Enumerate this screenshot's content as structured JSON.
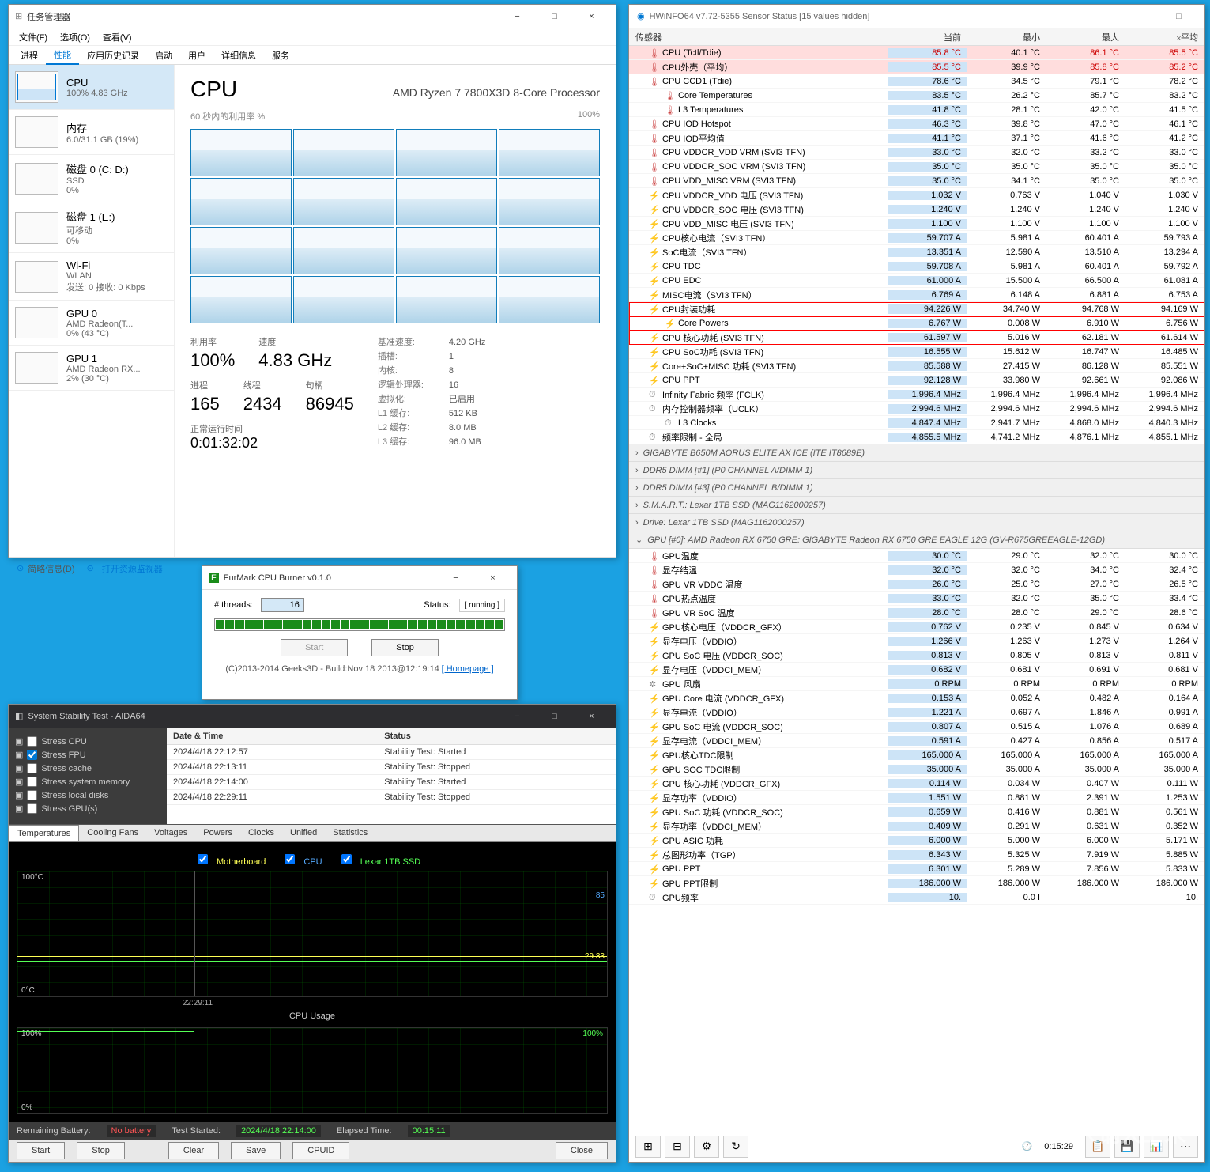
{
  "taskmgr": {
    "title": "任务管理器",
    "menu": [
      "文件(F)",
      "选项(O)",
      "查看(V)"
    ],
    "tabs": [
      "进程",
      "性能",
      "应用历史记录",
      "启动",
      "用户",
      "详细信息",
      "服务"
    ],
    "activeTab": 1,
    "sideItems": [
      {
        "name": "CPU",
        "sub": "100% 4.83 GHz",
        "active": true
      },
      {
        "name": "内存",
        "sub": "6.0/31.1 GB (19%)"
      },
      {
        "name": "磁盘 0 (C: D:)",
        "sub": "SSD\n0%"
      },
      {
        "name": "磁盘 1 (E:)",
        "sub": "可移动\n0%"
      },
      {
        "name": "Wi-Fi",
        "sub": "WLAN\n发送: 0 接收: 0 Kbps"
      },
      {
        "name": "GPU 0",
        "sub": "AMD Radeon(T...\n0% (43 °C)"
      },
      {
        "name": "GPU 1",
        "sub": "AMD Radeon RX...\n2% (30 °C)"
      }
    ],
    "cpuTitle": "CPU",
    "cpuModel": "AMD Ryzen 7 7800X3D 8-Core Processor",
    "graphLabel": "60 秒内的利用率 %",
    "graphMax": "100%",
    "stats": {
      "util": {
        "lbl": "利用率",
        "val": "100%"
      },
      "speed": {
        "lbl": "速度",
        "val": "4.83 GHz"
      },
      "proc": {
        "lbl": "进程",
        "val": "165"
      },
      "threads": {
        "lbl": "线程",
        "val": "2434"
      },
      "handles": {
        "lbl": "句柄",
        "val": "86945"
      },
      "uptime": {
        "lbl": "正常运行时间",
        "val": "0:01:32:02"
      }
    },
    "info": [
      {
        "k": "基准速度:",
        "v": "4.20 GHz"
      },
      {
        "k": "插槽:",
        "v": "1"
      },
      {
        "k": "内核:",
        "v": "8"
      },
      {
        "k": "逻辑处理器:",
        "v": "16"
      },
      {
        "k": "虚拟化:",
        "v": "已启用"
      },
      {
        "k": "L1 缓存:",
        "v": "512 KB"
      },
      {
        "k": "L2 缓存:",
        "v": "8.0 MB"
      },
      {
        "k": "L3 缓存:",
        "v": "96.0 MB"
      }
    ],
    "footer": {
      "label": "简略信息(D)",
      "link": "打开资源监视器"
    }
  },
  "furmark": {
    "title": "FurMark CPU Burner v0.1.0",
    "threadsLabel": "# threads:",
    "threads": "16",
    "statusLabel": "Status:",
    "status": "[ running ]",
    "start": "Start",
    "stop": "Stop",
    "footer": "(C)2013-2014 Geeks3D - Build:Nov 18 2013@12:19:14",
    "homepage": "[ Homepage ]"
  },
  "aida": {
    "title": "System Stability Test - AIDA64",
    "checks": [
      {
        "label": "Stress CPU",
        "checked": false
      },
      {
        "label": "Stress FPU",
        "checked": true
      },
      {
        "label": "Stress cache",
        "checked": false
      },
      {
        "label": "Stress system memory",
        "checked": false
      },
      {
        "label": "Stress local disks",
        "checked": false
      },
      {
        "label": "Stress GPU(s)",
        "checked": false
      }
    ],
    "logHeaders": [
      "Date & Time",
      "Status"
    ],
    "log": [
      {
        "dt": "2024/4/18 22:12:57",
        "st": "Stability Test: Started"
      },
      {
        "dt": "2024/4/18 22:13:11",
        "st": "Stability Test: Stopped"
      },
      {
        "dt": "2024/4/18 22:14:00",
        "st": "Stability Test: Started"
      },
      {
        "dt": "2024/4/18 22:29:11",
        "st": "Stability Test: Stopped"
      }
    ],
    "chartTabs": [
      "Temperatures",
      "Cooling Fans",
      "Voltages",
      "Powers",
      "Clocks",
      "Unified",
      "Statistics"
    ],
    "legend": [
      "Motherboard",
      "CPU",
      "Lexar 1TB SSD"
    ],
    "tempMax": "100°C",
    "tempMin": "0°C",
    "tempMarks": {
      "hi": "85",
      "mid": "29 33"
    },
    "timeMark": "22:29:11",
    "cpuUsageTitle": "CPU Usage",
    "usageMax": "100%",
    "usageMin": "0%",
    "status": {
      "battLabel": "Remaining Battery:",
      "batt": "No battery",
      "startLabel": "Test Started:",
      "start": "2024/4/18 22:14:00",
      "elapsedLabel": "Elapsed Time:",
      "elapsed": "00:15:11"
    },
    "btns": [
      "Start",
      "Stop",
      "Clear",
      "Save",
      "CPUID",
      "Close"
    ]
  },
  "hwinfo": {
    "title": "HWiNFO64 v7.72-5355 Sensor Status [15 values hidden]",
    "headers": {
      "sensor": "传感器",
      "cur": "当前",
      "min": "最小",
      "max": "最大",
      "avg": "平均"
    },
    "cpuRows": [
      {
        "name": "CPU (Tctl/Tdie)",
        "c": "85.8 °C",
        "mn": "40.1 °C",
        "mx": "86.1 °C",
        "av": "85.5 °C",
        "hl": true,
        "icon": "🌡"
      },
      {
        "name": "CPU外壳（平均）",
        "c": "85.5 °C",
        "mn": "39.9 °C",
        "mx": "85.8 °C",
        "av": "85.2 °C",
        "hl": true,
        "icon": "🌡"
      },
      {
        "name": "CPU CCD1 (Tdie)",
        "c": "78.6 °C",
        "mn": "34.5 °C",
        "mx": "79.1 °C",
        "av": "78.2 °C",
        "icon": "🌡"
      },
      {
        "name": "Core Temperatures",
        "c": "83.5 °C",
        "mn": "26.2 °C",
        "mx": "85.7 °C",
        "av": "83.2 °C",
        "icon": "🌡",
        "indent": true
      },
      {
        "name": "L3 Temperatures",
        "c": "41.8 °C",
        "mn": "28.1 °C",
        "mx": "42.0 °C",
        "av": "41.5 °C",
        "icon": "🌡",
        "indent": true
      },
      {
        "name": "CPU IOD Hotspot",
        "c": "46.3 °C",
        "mn": "39.8 °C",
        "mx": "47.0 °C",
        "av": "46.1 °C",
        "icon": "🌡"
      },
      {
        "name": "CPU IOD平均值",
        "c": "41.1 °C",
        "mn": "37.1 °C",
        "mx": "41.6 °C",
        "av": "41.2 °C",
        "icon": "🌡"
      },
      {
        "name": "CPU VDDCR_VDD VRM (SVI3 TFN)",
        "c": "33.0 °C",
        "mn": "32.0 °C",
        "mx": "33.2 °C",
        "av": "33.0 °C",
        "icon": "🌡"
      },
      {
        "name": "CPU VDDCR_SOC VRM (SVI3 TFN)",
        "c": "35.0 °C",
        "mn": "35.0 °C",
        "mx": "35.0 °C",
        "av": "35.0 °C",
        "icon": "🌡"
      },
      {
        "name": "CPU VDD_MISC VRM (SVI3 TFN)",
        "c": "35.0 °C",
        "mn": "34.1 °C",
        "mx": "35.0 °C",
        "av": "35.0 °C",
        "icon": "🌡"
      },
      {
        "name": "CPU VDDCR_VDD 电压 (SVI3 TFN)",
        "c": "1.032 V",
        "mn": "0.763 V",
        "mx": "1.040 V",
        "av": "1.030 V",
        "icon": "⚡"
      },
      {
        "name": "CPU VDDCR_SOC 电压 (SVI3 TFN)",
        "c": "1.240 V",
        "mn": "1.240 V",
        "mx": "1.240 V",
        "av": "1.240 V",
        "icon": "⚡"
      },
      {
        "name": "CPU VDD_MISC 电压 (SVI3 TFN)",
        "c": "1.100 V",
        "mn": "1.100 V",
        "mx": "1.100 V",
        "av": "1.100 V",
        "icon": "⚡"
      },
      {
        "name": "CPU核心电流（SVI3 TFN）",
        "c": "59.707 A",
        "mn": "5.981 A",
        "mx": "60.401 A",
        "av": "59.793 A",
        "icon": "⚡"
      },
      {
        "name": "SoC电流（SVI3 TFN）",
        "c": "13.351 A",
        "mn": "12.590 A",
        "mx": "13.510 A",
        "av": "13.294 A",
        "icon": "⚡"
      },
      {
        "name": "CPU TDC",
        "c": "59.708 A",
        "mn": "5.981 A",
        "mx": "60.401 A",
        "av": "59.792 A",
        "icon": "⚡"
      },
      {
        "name": "CPU EDC",
        "c": "61.000 A",
        "mn": "15.500 A",
        "mx": "66.500 A",
        "av": "61.081 A",
        "icon": "⚡"
      },
      {
        "name": "MISC电流（SVI3 TFN）",
        "c": "6.769 A",
        "mn": "6.148 A",
        "mx": "6.881 A",
        "av": "6.753 A",
        "icon": "⚡"
      },
      {
        "name": "CPU封装功耗",
        "c": "94.226 W",
        "mn": "34.740 W",
        "mx": "94.768 W",
        "av": "94.169 W",
        "icon": "⚡",
        "box": true
      },
      {
        "name": "Core Powers",
        "c": "6.767 W",
        "mn": "0.008 W",
        "mx": "6.910 W",
        "av": "6.756 W",
        "icon": "⚡",
        "box": true,
        "indent": true
      },
      {
        "name": "CPU 核心功耗 (SVI3 TFN)",
        "c": "61.597 W",
        "mn": "5.016 W",
        "mx": "62.181 W",
        "av": "61.614 W",
        "icon": "⚡",
        "box": true
      },
      {
        "name": "CPU SoC功耗 (SVI3 TFN)",
        "c": "16.555 W",
        "mn": "15.612 W",
        "mx": "16.747 W",
        "av": "16.485 W",
        "icon": "⚡"
      },
      {
        "name": "Core+SoC+MISC 功耗 (SVI3 TFN)",
        "c": "85.588 W",
        "mn": "27.415 W",
        "mx": "86.128 W",
        "av": "85.551 W",
        "icon": "⚡"
      },
      {
        "name": "CPU PPT",
        "c": "92.128 W",
        "mn": "33.980 W",
        "mx": "92.661 W",
        "av": "92.086 W",
        "icon": "⚡"
      },
      {
        "name": "Infinity Fabric 频率 (FCLK)",
        "c": "1,996.4 MHz",
        "mn": "1,996.4 MHz",
        "mx": "1,996.4 MHz",
        "av": "1,996.4 MHz",
        "icon": "⏱"
      },
      {
        "name": "内存控制器频率（UCLK）",
        "c": "2,994.6 MHz",
        "mn": "2,994.6 MHz",
        "mx": "2,994.6 MHz",
        "av": "2,994.6 MHz",
        "icon": "⏱"
      },
      {
        "name": "L3 Clocks",
        "c": "4,847.4 MHz",
        "mn": "2,941.7 MHz",
        "mx": "4,868.0 MHz",
        "av": "4,840.3 MHz",
        "icon": "⏱",
        "indent": true
      },
      {
        "name": "频率限制 - 全局",
        "c": "4,855.5 MHz",
        "mn": "4,741.2 MHz",
        "mx": "4,876.1 MHz",
        "av": "4,855.1 MHz",
        "icon": "⏱"
      }
    ],
    "sections": [
      "GIGABYTE B650M AORUS ELITE AX ICE (ITE IT8689E)",
      "DDR5 DIMM [#1] (P0 CHANNEL A/DIMM 1)",
      "DDR5 DIMM [#3] (P0 CHANNEL B/DIMM 1)",
      "S.M.A.R.T.: Lexar 1TB SSD (MAG1162000257)",
      "Drive: Lexar 1TB SSD (MAG1162000257)"
    ],
    "gpuSection": "GPU [#0]: AMD Radeon RX 6750 GRE: GIGABYTE Radeon RX 6750 GRE EAGLE 12G (GV-R675GREEAGLE-12GD)",
    "gpuRows": [
      {
        "name": "GPU温度",
        "c": "30.0 °C",
        "mn": "29.0 °C",
        "mx": "32.0 °C",
        "av": "30.0 °C",
        "icon": "🌡"
      },
      {
        "name": "显存结温",
        "c": "32.0 °C",
        "mn": "32.0 °C",
        "mx": "34.0 °C",
        "av": "32.4 °C",
        "icon": "🌡"
      },
      {
        "name": "GPU VR VDDC 温度",
        "c": "26.0 °C",
        "mn": "25.0 °C",
        "mx": "27.0 °C",
        "av": "26.5 °C",
        "icon": "🌡"
      },
      {
        "name": "GPU热点温度",
        "c": "33.0 °C",
        "mn": "32.0 °C",
        "mx": "35.0 °C",
        "av": "33.4 °C",
        "icon": "🌡"
      },
      {
        "name": "GPU VR SoC 温度",
        "c": "28.0 °C",
        "mn": "28.0 °C",
        "mx": "29.0 °C",
        "av": "28.6 °C",
        "icon": "🌡"
      },
      {
        "name": "GPU核心电压（VDDCR_GFX）",
        "c": "0.762 V",
        "mn": "0.235 V",
        "mx": "0.845 V",
        "av": "0.634 V",
        "icon": "⚡"
      },
      {
        "name": "显存电压（VDDIO）",
        "c": "1.266 V",
        "mn": "1.263 V",
        "mx": "1.273 V",
        "av": "1.264 V",
        "icon": "⚡"
      },
      {
        "name": "GPU SoC 电压 (VDDCR_SOC)",
        "c": "0.813 V",
        "mn": "0.805 V",
        "mx": "0.813 V",
        "av": "0.811 V",
        "icon": "⚡"
      },
      {
        "name": "显存电压（VDDCI_MEM）",
        "c": "0.682 V",
        "mn": "0.681 V",
        "mx": "0.691 V",
        "av": "0.681 V",
        "icon": "⚡"
      },
      {
        "name": "GPU 风扇",
        "c": "0 RPM",
        "mn": "0 RPM",
        "mx": "0 RPM",
        "av": "0 RPM",
        "icon": "✲"
      },
      {
        "name": "GPU Core 电流 (VDDCR_GFX)",
        "c": "0.153 A",
        "mn": "0.052 A",
        "mx": "0.482 A",
        "av": "0.164 A",
        "icon": "⚡"
      },
      {
        "name": "显存电流（VDDIO）",
        "c": "1.221 A",
        "mn": "0.697 A",
        "mx": "1.846 A",
        "av": "0.991 A",
        "icon": "⚡"
      },
      {
        "name": "GPU SoC 电流 (VDDCR_SOC)",
        "c": "0.807 A",
        "mn": "0.515 A",
        "mx": "1.076 A",
        "av": "0.689 A",
        "icon": "⚡"
      },
      {
        "name": "显存电流（VDDCI_MEM）",
        "c": "0.591 A",
        "mn": "0.427 A",
        "mx": "0.856 A",
        "av": "0.517 A",
        "icon": "⚡"
      },
      {
        "name": "GPU核心TDC限制",
        "c": "165.000 A",
        "mn": "165.000 A",
        "mx": "165.000 A",
        "av": "165.000 A",
        "icon": "⚡"
      },
      {
        "name": "GPU SOC TDC限制",
        "c": "35.000 A",
        "mn": "35.000 A",
        "mx": "35.000 A",
        "av": "35.000 A",
        "icon": "⚡"
      },
      {
        "name": "GPU 核心功耗 (VDDCR_GFX)",
        "c": "0.114 W",
        "mn": "0.034 W",
        "mx": "0.407 W",
        "av": "0.111 W",
        "icon": "⚡"
      },
      {
        "name": "显存功率（VDDIO）",
        "c": "1.551 W",
        "mn": "0.881 W",
        "mx": "2.391 W",
        "av": "1.253 W",
        "icon": "⚡"
      },
      {
        "name": "GPU SoC 功耗 (VDDCR_SOC)",
        "c": "0.659 W",
        "mn": "0.416 W",
        "mx": "0.881 W",
        "av": "0.561 W",
        "icon": "⚡"
      },
      {
        "name": "显存功率（VDDCI_MEM）",
        "c": "0.409 W",
        "mn": "0.291 W",
        "mx": "0.631 W",
        "av": "0.352 W",
        "icon": "⚡"
      },
      {
        "name": "GPU ASIC 功耗",
        "c": "6.000 W",
        "mn": "5.000 W",
        "mx": "6.000 W",
        "av": "5.171 W",
        "icon": "⚡"
      },
      {
        "name": "总图形功率（TGP）",
        "c": "6.343 W",
        "mn": "5.325 W",
        "mx": "7.919 W",
        "av": "5.885 W",
        "icon": "⚡"
      },
      {
        "name": "GPU PPT",
        "c": "6.301 W",
        "mn": "5.289 W",
        "mx": "7.856 W",
        "av": "5.833 W",
        "icon": "⚡"
      },
      {
        "name": "GPU PPT限制",
        "c": "186.000 W",
        "mn": "186.000 W",
        "mx": "186.000 W",
        "av": "186.000 W",
        "icon": "⚡"
      },
      {
        "name": "GPU频率",
        "c": "10.",
        "mn": "0.0 I",
        "mx": "",
        "av": "10.",
        "icon": "⏱"
      }
    ],
    "clock": "0:15:29"
  },
  "watermark": "知乎 @奕口大锅天上来"
}
